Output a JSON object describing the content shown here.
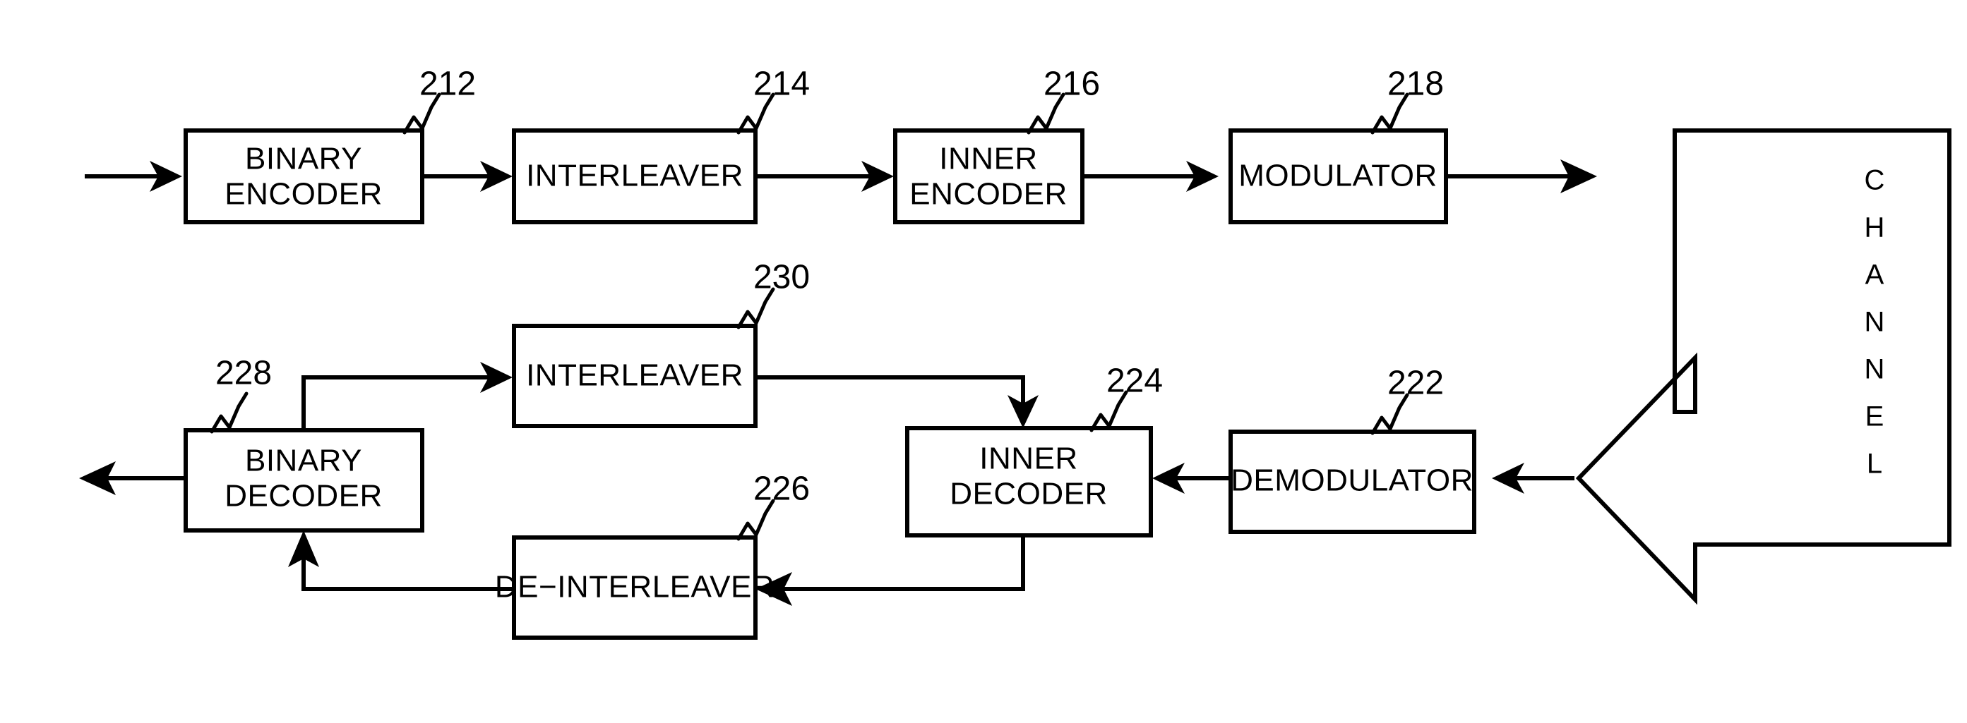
{
  "figure": {
    "type": "patent-block-diagram",
    "background_color": "#ffffff",
    "line_color": "#000000"
  },
  "blocks": {
    "binary_encoder": {
      "label_line1": "BINARY",
      "label_line2": "ENCODER",
      "ref": "212"
    },
    "interleaver_tx": {
      "label_line1": "INTERLEAVER",
      "label_line2": "",
      "ref": "214"
    },
    "inner_encoder": {
      "label_line1": "INNER",
      "label_line2": "ENCODER",
      "ref": "216"
    },
    "modulator": {
      "label_line1": "MODULATOR",
      "label_line2": "",
      "ref": "218"
    },
    "interleaver_rx": {
      "label_line1": "INTERLEAVER",
      "label_line2": "",
      "ref": "230"
    },
    "binary_decoder": {
      "label_line1": "BINARY",
      "label_line2": "DECODER",
      "ref": "228"
    },
    "inner_decoder": {
      "label_line1": "INNER",
      "label_line2": "DECODER",
      "ref": "224"
    },
    "de_interleaver": {
      "label_line1": "DE−INTERLEAVER",
      "label_line2": "",
      "ref": "226"
    },
    "demodulator": {
      "label_line1": "DEMODULATOR",
      "label_line2": "",
      "ref": "222"
    }
  },
  "channel": {
    "label": "CHANNEL",
    "letters": [
      "C",
      "H",
      "A",
      "N",
      "N",
      "E",
      "L"
    ]
  }
}
